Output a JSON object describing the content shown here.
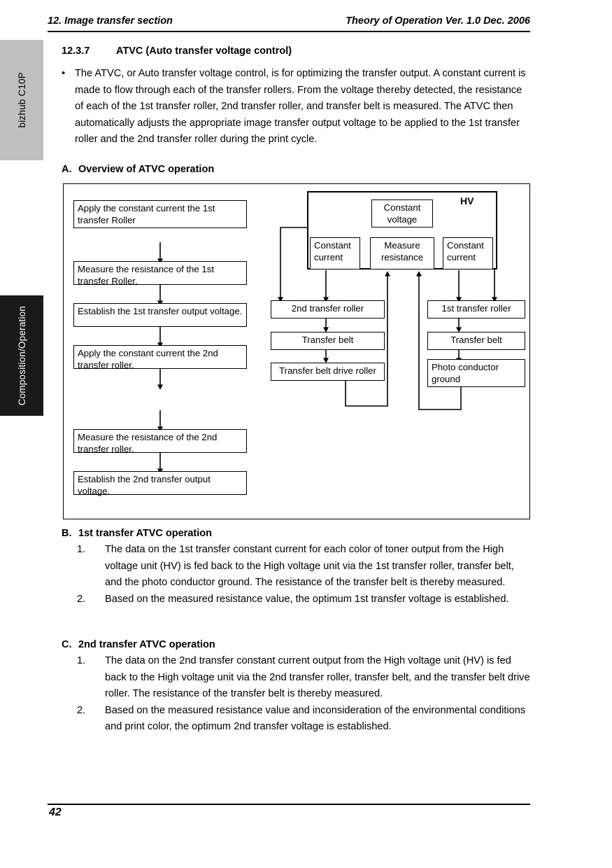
{
  "side_tabs": {
    "product": "bizhub C10P",
    "chapter": "Composition/Operation"
  },
  "header": {
    "left": "12. Image transfer section",
    "right": "Theory of Operation Ver. 1.0 Dec. 2006"
  },
  "section": {
    "number": "12.3.7",
    "title": "ATVC (Auto transfer voltage control)",
    "bullet_mark": "•",
    "intro": "The ATVC, or Auto transfer voltage control, is for optimizing the transfer output. A constant current is made to flow through each of the transfer rollers. From the voltage thereby detected, the resistance of each of the 1st transfer roller, 2nd transfer roller, and transfer belt is measured. The ATVC then automatically adjusts the appropriate image transfer output voltage to be applied to the 1st transfer roller and the 2nd transfer roller during the print cycle."
  },
  "subsection_a": {
    "letter": "A.",
    "title": "Overview of ATVC operation"
  },
  "diagram": {
    "hv_label": "HV",
    "flow_steps": [
      "Apply the constant current the 1st transfer Roller",
      "Measure the resistance of the 1st transfer Roller.",
      "Establish the 1st transfer output voltage.",
      "Apply the constant current the 2nd transfer roller.",
      "Measure the resistance of the 2nd transfer roller.",
      "Establish the 2nd transfer output voltage."
    ],
    "hv_blocks": {
      "constant_voltage": "Constant voltage",
      "constant_current_left": "Constant current",
      "measure_resistance": "Measure resistance",
      "constant_current_right": "Constant current"
    },
    "path_2nd": [
      "2nd transfer roller",
      "Transfer belt",
      "Transfer belt drive roller"
    ],
    "path_1st": [
      "1st transfer roller",
      "Transfer belt",
      "Photo conductor ground"
    ]
  },
  "subsection_b": {
    "letter": "B.",
    "title": "1st transfer ATVC operation",
    "items": [
      {
        "n": "1.",
        "text": "The data on the 1st transfer constant current for each color of toner output from the High voltage unit (HV) is fed back to the High voltage unit via the 1st transfer roller, transfer belt, and the photo conductor ground. The resistance of the transfer belt is thereby measured."
      },
      {
        "n": "2.",
        "text": "Based on the measured resistance value, the optimum 1st transfer voltage is established."
      }
    ]
  },
  "subsection_c": {
    "letter": "C.",
    "title": "2nd transfer ATVC operation",
    "items": [
      {
        "n": "1.",
        "text": "The data on the 2nd transfer constant current output from the High voltage unit (HV) is fed back to the High voltage unit via the 2nd transfer roller, transfer belt, and the transfer belt drive roller. The resistance of the transfer belt is thereby measured."
      },
      {
        "n": "2.",
        "text": "Based on the measured resistance value and inconsideration of the environmental conditions and print color, the optimum 2nd transfer voltage is established."
      }
    ]
  },
  "footer": {
    "page_number": "42"
  }
}
